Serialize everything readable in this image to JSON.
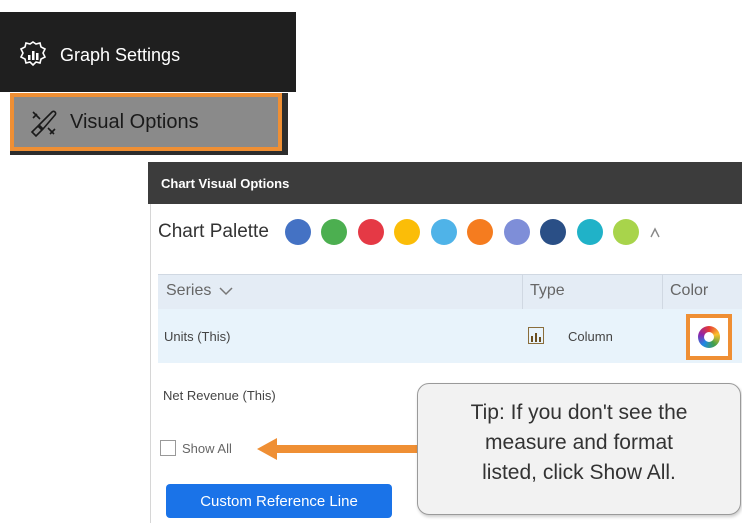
{
  "menu": {
    "graph_settings": {
      "label": "Graph Settings",
      "icon": "graph-settings-icon"
    },
    "visual_options": {
      "label": "Visual Options",
      "icon": "paint-palette-icon"
    }
  },
  "panel": {
    "title": "Chart Visual Options",
    "palette": {
      "label": "Chart Palette",
      "colors": [
        "#4472c4",
        "#4caf50",
        "#e53945",
        "#fbbd08",
        "#4fb3e8",
        "#f57c1f",
        "#7e8ed8",
        "#2a4f86",
        "#20b2c8",
        "#a8d44b"
      ]
    },
    "table": {
      "columns": {
        "series": "Series",
        "type": "Type",
        "color": "Color"
      },
      "rows": [
        {
          "series": "Units (This)",
          "type": "Column",
          "icon": "column-chart-icon"
        },
        {
          "series": "Net Revenue (This)"
        }
      ]
    },
    "show_all": {
      "label": "Show All",
      "checked": false
    },
    "custom_reference_line": "Custom Reference Line"
  },
  "tip": {
    "text": "Tip: If you don't see the\nmeasure and format\nlisted, click Show All."
  },
  "highlight_color": "#ef8f34",
  "accent_color": "#1a73e8"
}
